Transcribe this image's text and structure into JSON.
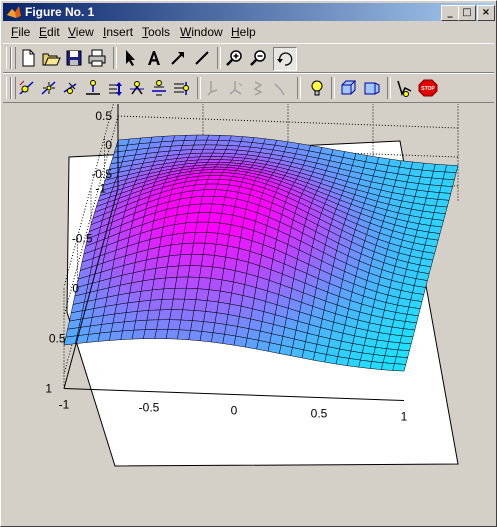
{
  "window": {
    "title": "Figure No. 1",
    "controls": {
      "minimize": "_",
      "maximize": "□",
      "close": "×"
    }
  },
  "menu": [
    {
      "label": "File",
      "underline": "F",
      "rest": "ile"
    },
    {
      "label": "Edit",
      "underline": "E",
      "rest": "dit"
    },
    {
      "label": "View",
      "underline": "V",
      "rest": "iew"
    },
    {
      "label": "Insert",
      "underline": "I",
      "rest": "nsert"
    },
    {
      "label": "Tools",
      "underline": "T",
      "rest": "ools"
    },
    {
      "label": "Window",
      "underline": "W",
      "rest": "indow"
    },
    {
      "label": "Help",
      "underline": "H",
      "rest": "elp"
    }
  ],
  "toolbar1": [
    "new-file-icon",
    "open-folder-icon",
    "save-disk-icon",
    "print-icon",
    "select-arrow-icon",
    "insert-text-icon",
    "insert-arrow-icon",
    "insert-line-icon",
    "zoom-in-icon",
    "zoom-out-icon",
    "rotate-3d-icon"
  ],
  "toolbar2": [
    "camera-orbit-icon",
    "camera-orbit-scene-light-icon",
    "camera-pan-tilt-icon",
    "camera-move-horizontal-icon",
    "camera-move-forward-back-icon",
    "camera-zoom-icon",
    "camera-roll-icon",
    "camera-dolly-icon",
    "principal-axis-x-icon",
    "principal-axis-y-icon",
    "principal-axis-z-icon",
    "no-principal-axis-icon",
    "scene-light-icon",
    "orthographic-projection-icon",
    "perspective-projection-icon",
    "reset-camera-icon",
    "stop-camera-icon"
  ],
  "stop_label": "STOP",
  "colors": {
    "surface_low": "#00ffff",
    "surface_high": "#ff00ff",
    "mesh": "#000000",
    "axes_bg": "#ffffff",
    "figure_bg": "#d4d0c8"
  },
  "z_ticks": [
    "1",
    "0.5",
    "0",
    "-0.5"
  ],
  "y_ticks": [
    "-1",
    "-0.5",
    "0",
    "0.5",
    "1"
  ],
  "x_ticks": [
    "-1",
    "-0.5",
    "0",
    "0.5",
    "1"
  ]
}
